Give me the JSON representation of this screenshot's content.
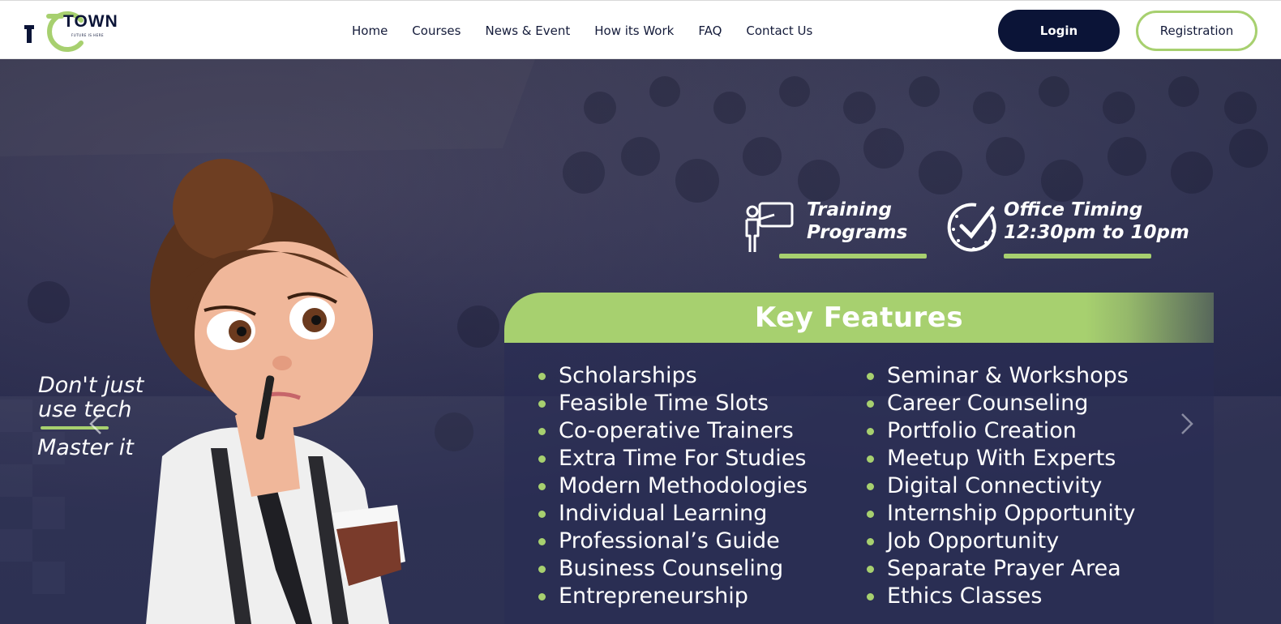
{
  "logo": {
    "text": "TOWN",
    "tagline": "FUTURE IS HERE",
    "brand_green": "#a7d06f",
    "brand_navy": "#0b1437"
  },
  "nav": {
    "items": [
      "Home",
      "Courses",
      "News & Event",
      "How its Work",
      "FAQ",
      "Contact Us"
    ]
  },
  "header": {
    "login_label": "Login",
    "registration_label": "Registration"
  },
  "hero": {
    "tagline_lines": [
      "Don't just",
      "use tech"
    ],
    "tagline_last": "Master it",
    "prev_icon": "chevron-left-icon",
    "next_icon": "chevron-right-icon",
    "training": {
      "line1": "Training",
      "line2": "Programs",
      "icon": "teacher-presentation-icon"
    },
    "office": {
      "line1": "Office Timing",
      "line2": "12:30pm  to 10pm",
      "icon": "clock-check-icon"
    }
  },
  "key_features": {
    "title": "Key Features",
    "left": [
      "Scholarships",
      "Feasible Time Slots",
      "Co-operative Trainers",
      "Extra Time For Studies",
      "Modern Methodologies",
      "Individual Learning",
      "Professional’s Guide",
      "Business Counseling",
      "Entrepreneurship"
    ],
    "right": [
      "Seminar & Workshops",
      "Career Counseling",
      "Portfolio Creation",
      "Meetup With Experts",
      "Digital Connectivity",
      "Internship Opportunity",
      "Job Opportunity",
      "Separate Prayer Area",
      "Ethics Classes"
    ]
  }
}
